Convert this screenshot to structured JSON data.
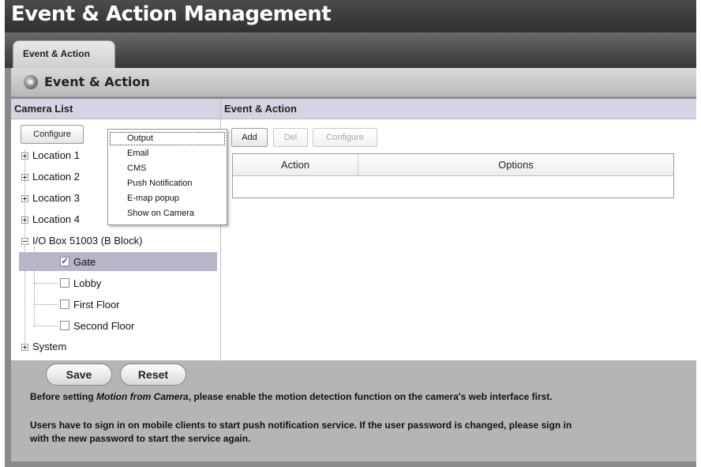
{
  "window": {
    "title": "Event & Action Management"
  },
  "tabs": [
    {
      "label": "Event & Action"
    }
  ],
  "panel": {
    "title": "Event & Action"
  },
  "camera_list": {
    "header": "Camera List",
    "configure_label": "Configure",
    "tree": [
      {
        "label": "Location 1",
        "expander": "+"
      },
      {
        "label": "Location 2",
        "expander": "+"
      },
      {
        "label": "Location 3",
        "expander": "+"
      },
      {
        "label": "Location 4",
        "expander": "+"
      },
      {
        "label": "I/O Box 51003 (B Block)",
        "expander": "-",
        "children": [
          {
            "label": "Gate",
            "checked": true,
            "selected": true
          },
          {
            "label": "Lobby",
            "checked": false
          },
          {
            "label": "First Floor",
            "checked": false
          },
          {
            "label": "Second Floor",
            "checked": false
          }
        ]
      },
      {
        "label": "System",
        "expander": "+"
      }
    ]
  },
  "configure_menu": {
    "items": [
      "Output",
      "Email",
      "CMS",
      "Push Notification",
      "E-map popup",
      "Show on Camera"
    ]
  },
  "event_action": {
    "header": "Event & Action",
    "add_label": "Add",
    "del_label": "Del",
    "configure_label": "Configure",
    "columns": [
      "Action",
      "Options"
    ]
  },
  "footer": {
    "save_label": "Save",
    "reset_label": "Reset",
    "note1_pre": "Before setting ",
    "note1_em": "Motion from Camera",
    "note1_post": ", please enable the motion detection function on the camera's web interface first.",
    "note2_line1": "Users have to sign in on mobile clients to start push notification service. If the user password is changed, please sign in",
    "note2_line2": "with the new password to start the service again."
  },
  "colors": {
    "selection": "#b6b6c8",
    "column_header": "#d4d4e4",
    "footer_bg": "#b5b5b5",
    "title_bar": "#3a3a3a"
  }
}
